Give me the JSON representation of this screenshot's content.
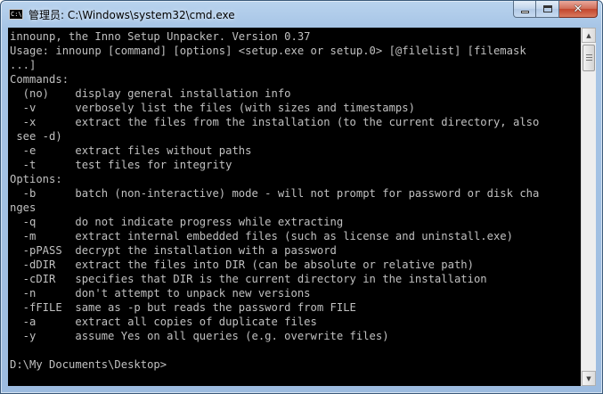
{
  "window": {
    "title": "管理员: C:\\Windows\\system32\\cmd.exe",
    "icon": "cmd-icon",
    "icon_text": "C:\\",
    "controls": {
      "minimize": "minimize",
      "maximize": "maximize",
      "close": "✕"
    }
  },
  "console": {
    "text": "innounp, the Inno Setup Unpacker. Version 0.37\nUsage: innounp [command] [options] <setup.exe or setup.0> [@filelist] [filemask\n...]\nCommands:\n  (no)    display general installation info\n  -v      verbosely list the files (with sizes and timestamps)\n  -x      extract the files from the installation (to the current directory, also\n see -d)\n  -e      extract files without paths\n  -t      test files for integrity\nOptions:\n  -b      batch (non-interactive) mode - will not prompt for password or disk cha\nnges\n  -q      do not indicate progress while extracting\n  -m      extract internal embedded files (such as license and uninstall.exe)\n  -pPASS  decrypt the installation with a password\n  -dDIR   extract the files into DIR (can be absolute or relative path)\n  -cDIR   specifies that DIR is the current directory in the installation\n  -n      don't attempt to unpack new versions\n  -fFILE  same as -p but reads the password from FILE\n  -a      extract all copies of duplicate files\n  -y      assume Yes on all queries (e.g. overwrite files)\n\nD:\\My Documents\\Desktop>"
  },
  "colors": {
    "console_bg": "#000000",
    "console_fg": "#c0c0c0",
    "frame": "#a7c5e6",
    "close": "#c2462d"
  },
  "scrollbar": {
    "up": "▲",
    "down": "▼"
  }
}
